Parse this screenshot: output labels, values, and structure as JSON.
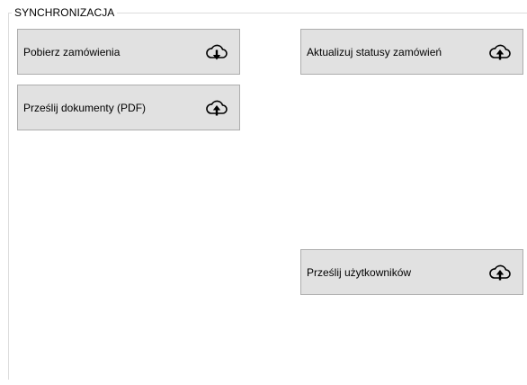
{
  "group": {
    "caption": "SYNCHRONIZACJA"
  },
  "buttons": {
    "download_orders": {
      "label": "Pobierz zamówienia",
      "icon": "cloud-download-icon"
    },
    "upload_documents": {
      "label": "Prześlij dokumenty (PDF)",
      "icon": "cloud-upload-icon"
    },
    "update_statuses": {
      "label": "Aktualizuj statusy zamówień",
      "icon": "cloud-upload-icon"
    },
    "upload_users": {
      "label": "Prześlij użytkowników",
      "icon": "cloud-upload-icon"
    }
  },
  "colors": {
    "button_face": "#e1e1e1",
    "button_border": "#adadad",
    "group_border": "#dcdcdc"
  }
}
